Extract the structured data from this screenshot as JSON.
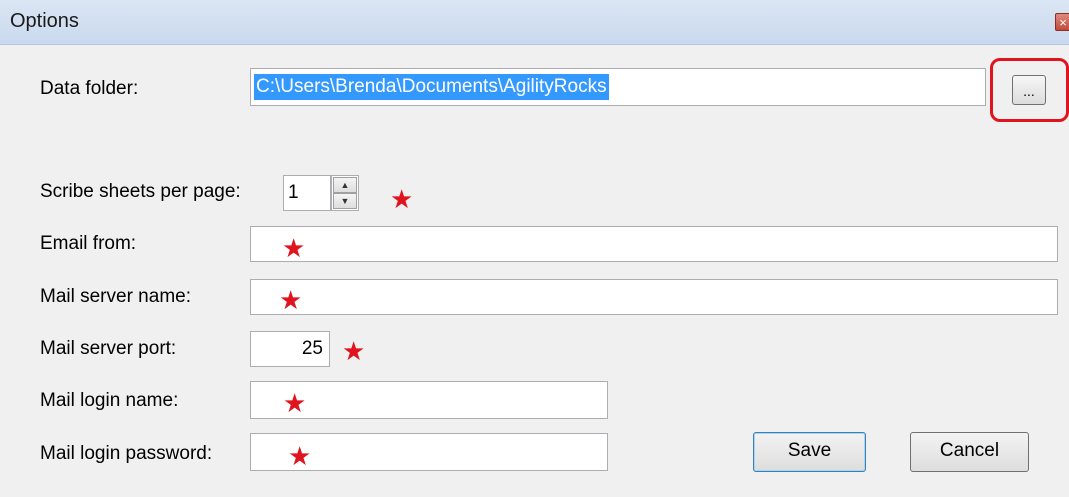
{
  "window": {
    "title": "Options",
    "close_glyph": "×"
  },
  "fields": {
    "data_folder": {
      "label": "Data folder:",
      "value": "C:\\Users\\Brenda\\Documents\\AgilityRocks",
      "browse_label": "..."
    },
    "scribe_sheets": {
      "label": "Scribe sheets per page:",
      "value": "1"
    },
    "email_from": {
      "label": "Email from:",
      "value": ""
    },
    "mail_server_name": {
      "label": "Mail server name:",
      "value": ""
    },
    "mail_server_port": {
      "label": "Mail server port:",
      "value": "25"
    },
    "mail_login_name": {
      "label": "Mail login name:",
      "value": ""
    },
    "mail_login_password": {
      "label": "Mail login password:",
      "value": ""
    }
  },
  "buttons": {
    "save": "Save",
    "cancel": "Cancel"
  },
  "annotations": {
    "star_glyph": "★",
    "star_color": "#e0141e",
    "highlight_color": "#e0141e"
  },
  "icons": {
    "spin_up": "▲",
    "spin_down": "▼"
  }
}
